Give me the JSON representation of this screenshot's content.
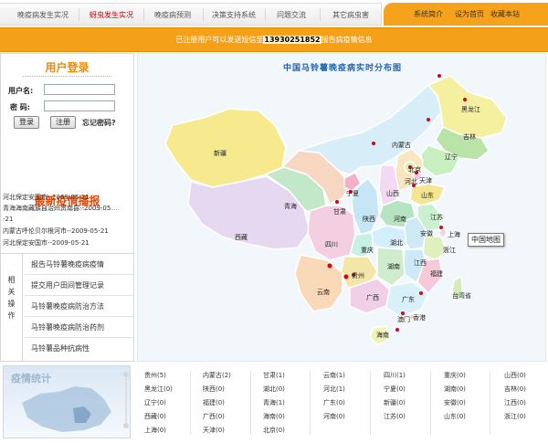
{
  "nav": {
    "tabs": [
      "晚疫病发生实况",
      "蚜虫发生实况",
      "晚疫病预测",
      "决策支持系统",
      "问题交流",
      "其它病虫害"
    ],
    "active_tab": 1,
    "right_links": [
      "系统简介",
      "设为首页",
      "收藏本站"
    ]
  },
  "banner": {
    "before": "已注册用户可以发送短信至",
    "phone": "13930251852",
    "after": "报告病疫情信息"
  },
  "login": {
    "title": "用户登录",
    "username_label": "用户名:",
    "password_label": "密  码:",
    "username_value": "",
    "password_value": "",
    "login_button": "登录",
    "register_button": "注册",
    "forgot_link": "忘记密码?"
  },
  "news": {
    "title": "最新疫情播报",
    "items": [
      "河北保定安国市--2009-05-21",
      "青海海南藏族自治州贵南县--2009-05",
      "-21",
      "内蒙古呼伦贝尔根河市--2009-05-21",
      "河北保定安国市--2009-05-21"
    ]
  },
  "operations": {
    "side_label": [
      "相",
      "关",
      "操",
      "作"
    ],
    "items": [
      "报告马铃薯晚疫病疫情",
      "提交用户田间管理记录",
      "马铃薯晚疫病防治方法",
      "马铃薯晚疫病防治药剂",
      "马铃薯品种抗病性"
    ]
  },
  "map": {
    "title": "中国马铃薯晚疫病实时分布图",
    "tooltip": "中国地图",
    "labels": [
      "黑龙江",
      "吉林",
      "辽宁",
      "内蒙古",
      "北京",
      "天津",
      "河北",
      "山西",
      "山东",
      "宁夏",
      "甘肃",
      "陕西",
      "河南",
      "江苏",
      "安徽",
      "上海",
      "新疆",
      "青海",
      "西藏",
      "四川",
      "重庆",
      "湖北",
      "浙江",
      "贵州",
      "湖南",
      "江西",
      "福建",
      "云南",
      "广西",
      "广东",
      "台湾省",
      "澳门",
      "香港",
      "海南"
    ]
  },
  "stats": {
    "title": "疫情统计",
    "rows": [
      [
        "贵州(5)",
        "内蒙古(2)",
        "甘肃(1)",
        "云南(1)",
        "四川(1)",
        "重庆(0)",
        "山西(0)"
      ],
      [
        "黑龙江(0)",
        "陕西(0)",
        "湖北(0)",
        "河北(1)",
        "宁夏(0)",
        "湖南(0)",
        "吉林(0)"
      ],
      [
        "辽宁(0)",
        "福建(0)",
        "青海(1)",
        "广东(0)",
        "新疆(0)",
        "安徽(0)",
        "江西(0)"
      ],
      [
        "西藏(0)",
        "广西(0)",
        "海南(0)",
        "河南(0)",
        "江苏(0)",
        "山东(0)",
        "浙江(0)"
      ],
      [
        "上海(0)",
        "天津(0)",
        "北京(0)",
        "",
        "",
        "",
        ""
      ]
    ]
  },
  "colors": {
    "accent_orange": "#f4a119",
    "active_tab": "#c00000",
    "title_orange": "#f08a00",
    "map_title": "#1d64b0",
    "outbreak_dot": "#d8001a"
  }
}
